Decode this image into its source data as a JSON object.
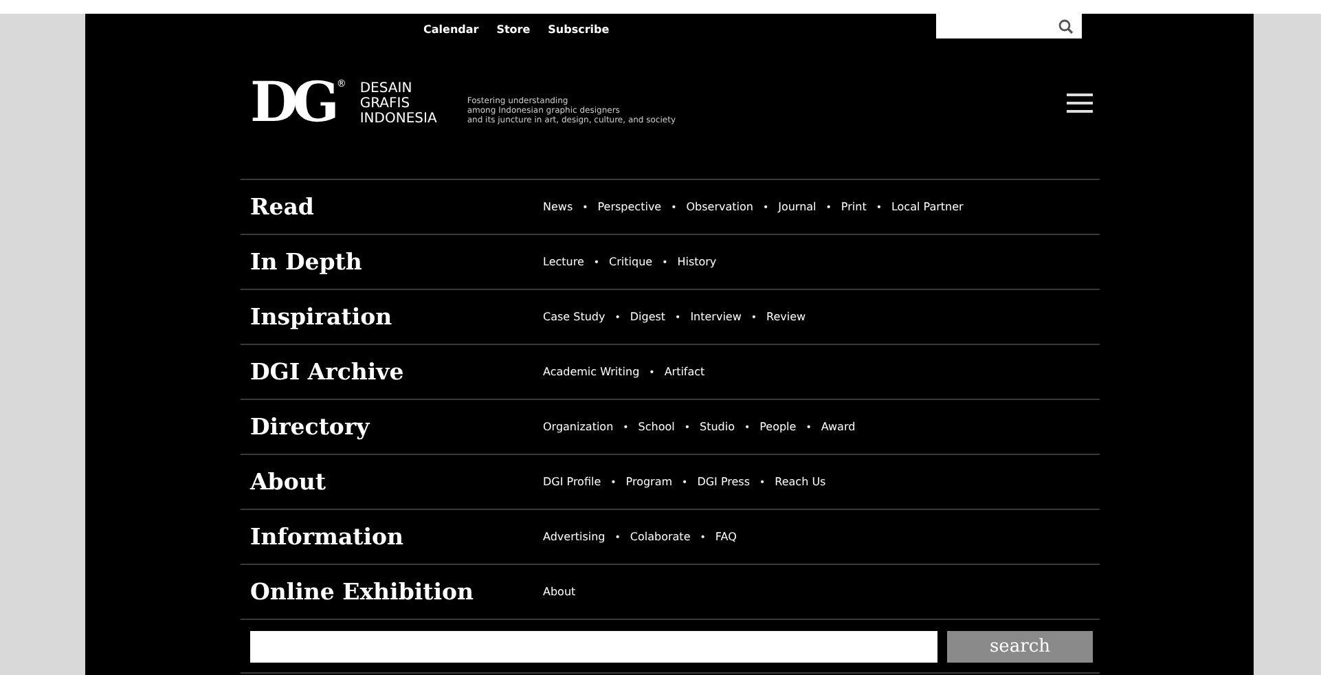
{
  "top_links": [
    "Calendar",
    "Store",
    "Subscribe"
  ],
  "logo": {
    "mark": "DG",
    "registered": "®",
    "name_lines": [
      "DESAIN",
      "GRAFIS",
      "INDONESIA"
    ],
    "tagline": [
      "Fostering understanding",
      "among Indonesian graphic designers",
      "and its juncture in art, design, culture, and society"
    ]
  },
  "link_separator": "•",
  "menu": [
    {
      "title": "Read",
      "links": [
        "News",
        "Perspective",
        "Observation",
        "Journal",
        "Print",
        "Local Partner"
      ]
    },
    {
      "title": "In Depth",
      "links": [
        "Lecture",
        "Critique",
        "History"
      ]
    },
    {
      "title": "Inspiration",
      "links": [
        "Case Study",
        "Digest",
        "Interview",
        "Review"
      ]
    },
    {
      "title": "DGI Archive",
      "links": [
        "Academic Writing",
        "Artifact"
      ]
    },
    {
      "title": "Directory",
      "links": [
        "Organization",
        "School",
        "Studio",
        "People",
        "Award"
      ]
    },
    {
      "title": "About",
      "links": [
        "DGI Profile",
        "Program",
        "DGI Press",
        "Reach Us"
      ]
    },
    {
      "title": "Information",
      "links": [
        "Advertising",
        "Colaborate",
        "FAQ"
      ]
    },
    {
      "title": "Online Exhibition",
      "links": [
        "About"
      ]
    }
  ],
  "search": {
    "button": "search"
  }
}
